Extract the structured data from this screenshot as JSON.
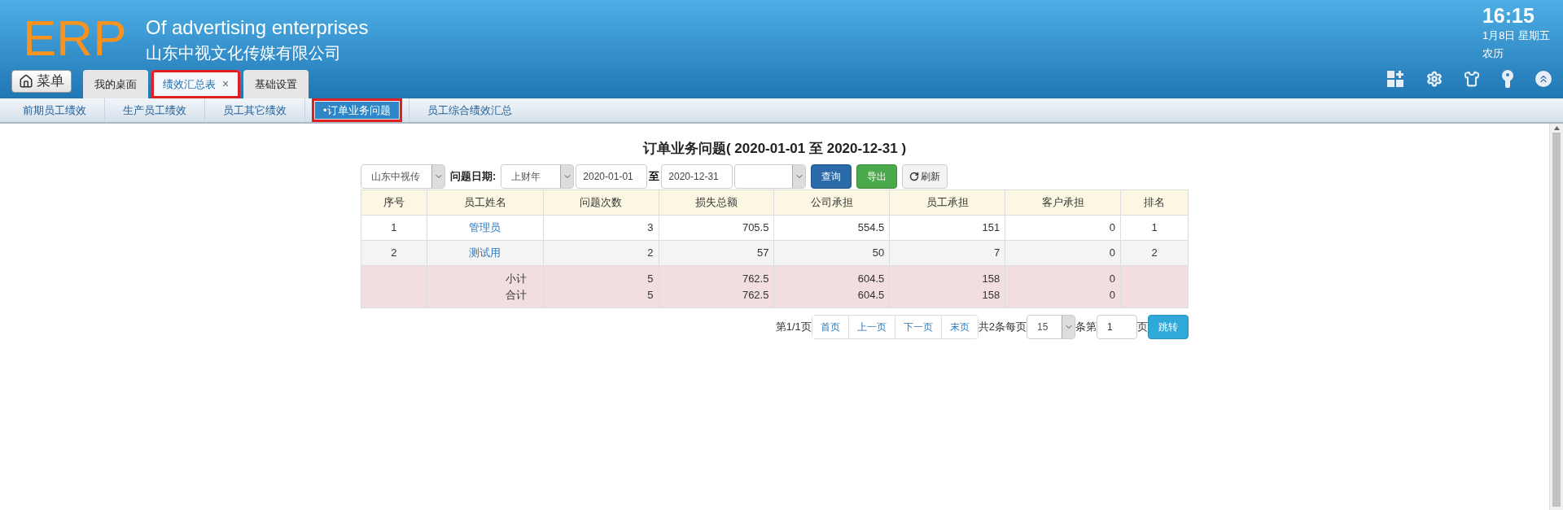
{
  "header": {
    "logo": "ERP",
    "title": "Of advertising enterprises",
    "company": "山东中视文化传媒有限公司",
    "menu_button": "菜单",
    "clock": {
      "time": "16:15",
      "date": "1月8日 星期五",
      "lunar": "农历"
    }
  },
  "tabs": [
    {
      "label": "我的桌面",
      "selected": false,
      "highlighted": false,
      "closable": false
    },
    {
      "label": "绩效汇总表",
      "selected": true,
      "highlighted": true,
      "closable": true,
      "close": "×"
    },
    {
      "label": "基础设置",
      "selected": false,
      "highlighted": false,
      "closable": false
    }
  ],
  "subtabs": [
    {
      "label": "前期员工绩效",
      "selected": false,
      "highlighted": false
    },
    {
      "label": "生产员工绩效",
      "selected": false,
      "highlighted": false
    },
    {
      "label": "员工其它绩效",
      "selected": false,
      "highlighted": false
    },
    {
      "label": "•订单业务问题",
      "selected": true,
      "highlighted": true
    },
    {
      "label": "员工综合绩效汇总",
      "selected": false,
      "highlighted": false
    }
  ],
  "report": {
    "title": "订单业务问题( 2020-01-01 至 2020-12-31 )",
    "filters": {
      "company": "山东中视传",
      "date_label": "问题日期:",
      "period": "上财年",
      "start": "2020-01-01",
      "to": "至",
      "end": "2020-12-31",
      "query": "查询",
      "export": "导出",
      "refresh": "刷新"
    },
    "columns": [
      "序号",
      "员工姓名",
      "问题次数",
      "损失总额",
      "公司承担",
      "员工承担",
      "客户承担",
      "排名"
    ],
    "rows": [
      {
        "cells": [
          "1",
          "管理员",
          "3",
          "705.5",
          "554.5",
          "151",
          "0",
          "1"
        ]
      },
      {
        "cells": [
          "2",
          "测试用",
          "2",
          "57",
          "50",
          "7",
          "0",
          "2"
        ]
      }
    ],
    "totals": [
      {
        "cells": [
          "",
          "小计",
          "5",
          "762.5",
          "604.5",
          "158",
          "0",
          ""
        ]
      },
      {
        "cells": [
          "",
          "合计",
          "5",
          "762.5",
          "604.5",
          "158",
          "0",
          ""
        ]
      }
    ],
    "pager": {
      "page_info": "第1/1页",
      "buttons": [
        "首页",
        "上一页",
        "下一页",
        "末页"
      ],
      "total": "共2条每页",
      "page_size": "15",
      "unit": "条第",
      "page": "1",
      "page_suffix": "页",
      "go": "跳转"
    }
  }
}
